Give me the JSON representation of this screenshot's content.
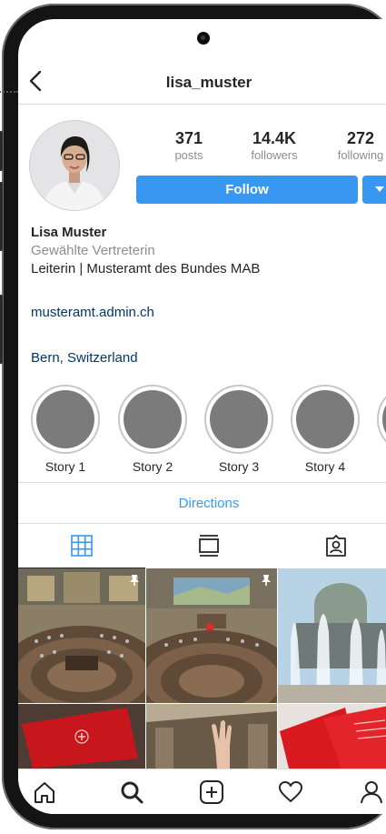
{
  "header": {
    "username": "lisa_muster"
  },
  "stats": {
    "posts": {
      "value": "371",
      "label": "posts"
    },
    "followers": {
      "value": "14.4K",
      "label": "followers"
    },
    "following": {
      "value": "272",
      "label": "following"
    }
  },
  "actions": {
    "follow_label": "Follow"
  },
  "bio": {
    "name": "Lisa Muster",
    "category": "Gewählte Vertreterin",
    "description": "Leiterin | Musteramt des Bundes MAB",
    "link": "musteramt.admin.ch",
    "location": "Bern, Switzerland"
  },
  "highlights": [
    {
      "label": "Story 1"
    },
    {
      "label": "Story 2"
    },
    {
      "label": "Story 3"
    },
    {
      "label": "Story 4"
    }
  ],
  "contact": {
    "directions_label": "Directions"
  },
  "tabs": [
    {
      "icon": "grid-icon",
      "active": true
    },
    {
      "icon": "feed-icon",
      "active": false
    },
    {
      "icon": "tagged-icon",
      "active": false
    }
  ],
  "posts": [
    {
      "subject": "parliament-chamber",
      "pinned": true
    },
    {
      "subject": "parliament-chamber",
      "pinned": true
    },
    {
      "subject": "federal-palace-fountain",
      "pinned": false
    },
    {
      "subject": "red-folder-document",
      "pinned": false
    },
    {
      "subject": "raised-hand-in-chamber",
      "pinned": false
    },
    {
      "subject": "red-brochure",
      "pinned": false
    }
  ],
  "bottom_nav": [
    {
      "icon": "home-icon"
    },
    {
      "icon": "search-icon"
    },
    {
      "icon": "new-post-icon"
    },
    {
      "icon": "activity-heart-icon"
    },
    {
      "icon": "profile-icon"
    }
  ],
  "colors": {
    "accent": "#3897f0",
    "link": "#00376b",
    "text": "#262626",
    "muted": "#8e8e8e",
    "story_fill": "#7b7b7b"
  }
}
